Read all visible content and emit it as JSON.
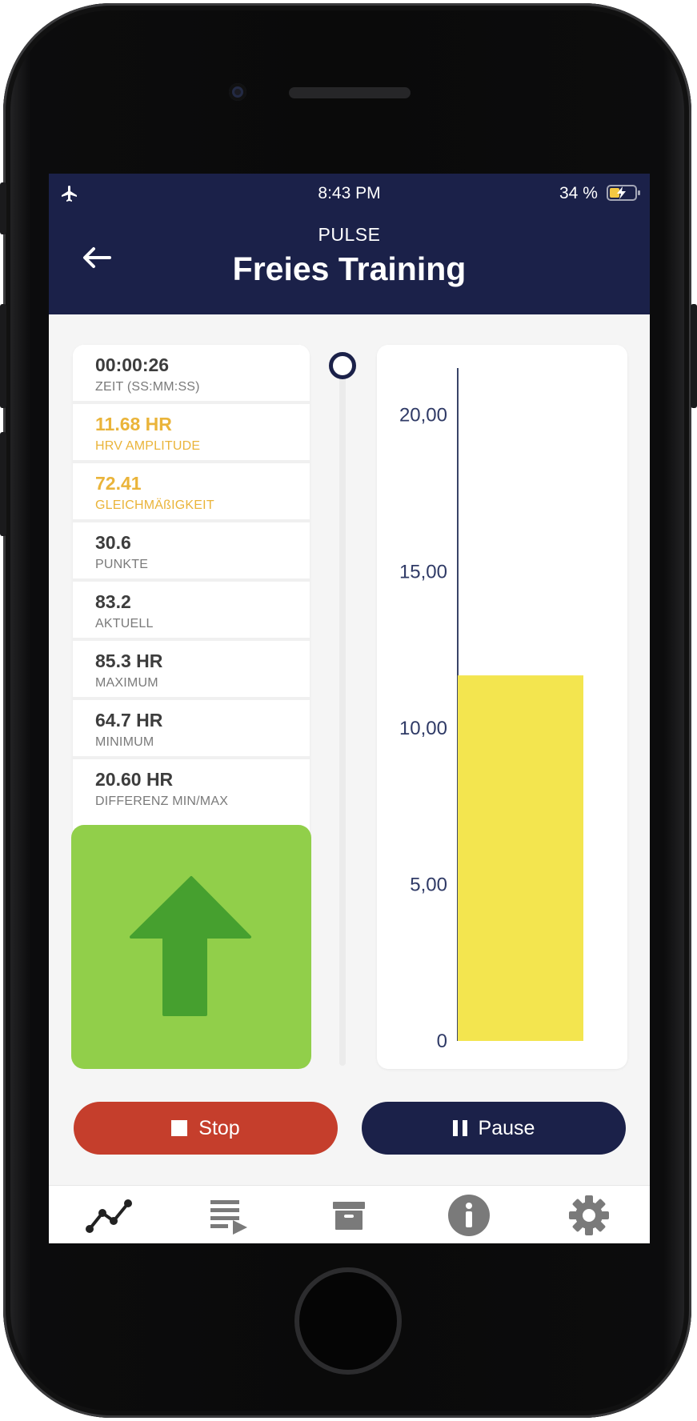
{
  "status_bar": {
    "time": "8:43 PM",
    "battery": "34 %",
    "airplane_icon": "airplane-icon",
    "battery_icon": "battery-charging-icon"
  },
  "header": {
    "subtitle": "PULSE",
    "title": "Freies Training",
    "back_icon": "arrow-left-icon"
  },
  "stats": [
    {
      "value": "00:00:26",
      "label": "ZEIT (SS:MM:SS)",
      "highlight": false
    },
    {
      "value": "11.68 HR",
      "label": "HRV AMPLITUDE",
      "highlight": true
    },
    {
      "value": "72.41",
      "label": "GLEICHMÄßIGKEIT",
      "highlight": true
    },
    {
      "value": "30.6",
      "label": "PUNKTE",
      "highlight": false
    },
    {
      "value": "83.2",
      "label": "AKTUELL",
      "highlight": false
    },
    {
      "value": "85.3 HR",
      "label": "MAXIMUM",
      "highlight": false
    },
    {
      "value": "64.7 HR",
      "label": "MINIMUM",
      "highlight": false
    },
    {
      "value": "20.60 HR",
      "label": "DIFFERENZ MIN/MAX",
      "highlight": false
    }
  ],
  "indicator": {
    "icon": "arrow-up-icon",
    "color": "#91cf4a",
    "arrow_color": "#46a02f"
  },
  "slider": {
    "value": 1.0
  },
  "chart_data": {
    "type": "bar",
    "categories": [
      ""
    ],
    "values": [
      11.68
    ],
    "ylim": [
      0,
      21.5
    ],
    "yticks": [
      "20,00",
      "15,00",
      "10,00",
      "5,00",
      "0"
    ],
    "ytick_values": [
      20,
      15,
      10,
      5,
      0
    ],
    "bar_color": "#f3e54f",
    "grid": false
  },
  "actions": {
    "stop_label": "Stop",
    "pause_label": "Pause",
    "stop_color": "#c53e2c",
    "pause_color": "#1b2149"
  },
  "tabbar": {
    "items": [
      {
        "icon": "line-chart-icon",
        "active": true
      },
      {
        "icon": "playlist-play-icon",
        "active": false
      },
      {
        "icon": "archive-box-icon",
        "active": false
      },
      {
        "icon": "info-icon",
        "active": false
      },
      {
        "icon": "gear-icon",
        "active": false
      }
    ]
  },
  "colors": {
    "navy": "#1b2149",
    "highlight_text": "#eab43a"
  }
}
